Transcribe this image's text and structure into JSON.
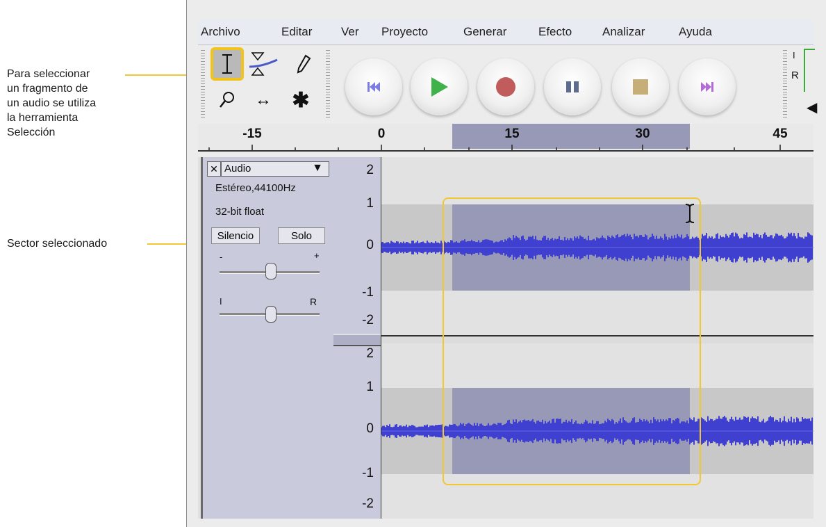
{
  "annotations": {
    "tool_callout": [
      "Para seleccionar",
      "un fragmento de",
      "un audio se utiliza",
      "la herramienta",
      "Selección"
    ],
    "selection_callout": "Sector seleccionado",
    "highlight_color": "#f2c319"
  },
  "menu": [
    "Archivo",
    "Editar",
    "Ver",
    "Proyecto",
    "Generar",
    "Efecto",
    "Analizar",
    "Ayuda"
  ],
  "tools": {
    "selection": "I-beam",
    "envelope": "envelope-icon",
    "draw": "pencil-icon",
    "zoom": "magnifier-icon",
    "timeshift": "↔",
    "multi": "✱"
  },
  "transport": [
    "skip-start-icon",
    "play-icon",
    "record-icon",
    "pause-icon",
    "stop-icon",
    "skip-end-icon"
  ],
  "meter": {
    "left": "I",
    "right": "R"
  },
  "ruler": {
    "ticks": [
      "-15",
      "0",
      "15",
      "30",
      "45"
    ]
  },
  "track": {
    "name": "Audio",
    "format": "Estéreo,44100Hz",
    "bitdepth": "32-bit float",
    "mute_label": "Silencio",
    "solo_label": "Solo",
    "gain_minus": "-",
    "gain_plus": "+",
    "pan_left": "I",
    "pan_right": "R",
    "close": "✕",
    "menu_arrow": "▼"
  },
  "vruler": {
    "top": [
      "2",
      "1",
      "0",
      "-1",
      "-2"
    ],
    "bottom": [
      "2",
      "1",
      "0",
      "-1",
      "-2"
    ]
  },
  "colors": {
    "waveform": "#3f3fd0",
    "selection": "#9899b6",
    "cursor_label": "I"
  }
}
